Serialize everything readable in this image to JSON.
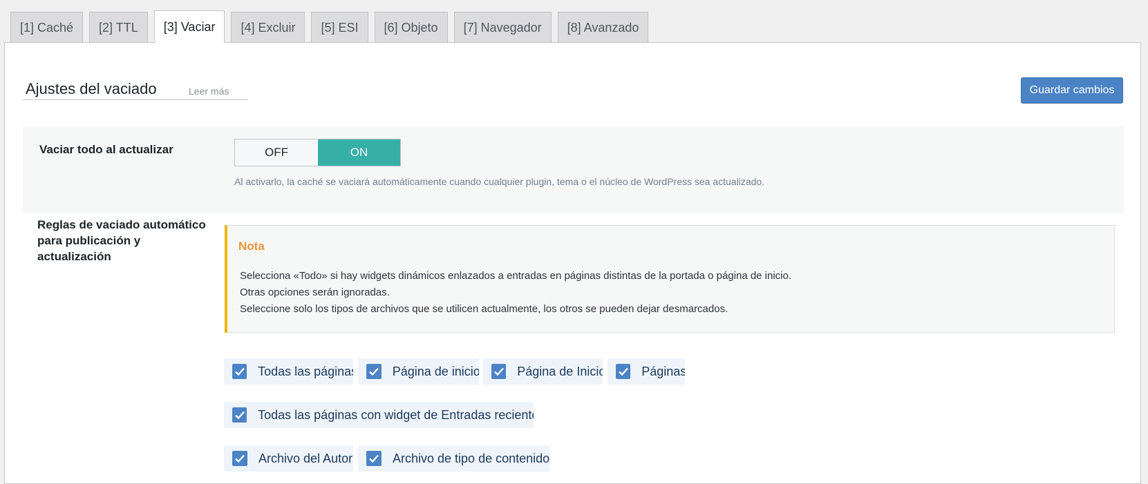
{
  "tabs": [
    {
      "label": "[1] Caché"
    },
    {
      "label": "[2] TTL"
    },
    {
      "label": "[3] Vaciar"
    },
    {
      "label": "[4] Excluir"
    },
    {
      "label": "[5] ESI"
    },
    {
      "label": "[6] Objeto"
    },
    {
      "label": "[7] Navegador"
    },
    {
      "label": "[8] Avanzado"
    }
  ],
  "active_tab": "[3] Vaciar",
  "section": {
    "title": "Ajustes del vaciado",
    "learn_more": "Leer más",
    "save_label": "Guardar cambios"
  },
  "purge_on_upgrade": {
    "label": "Vaciar todo al actualizar",
    "off_label": "OFF",
    "on_label": "ON",
    "state": "ON",
    "description": "Al activarlo, la caché se vaciará automáticamente cuando cualquier plugin, tema o el núcleo de WordPress sea actualizado."
  },
  "auto_purge": {
    "label_lines": [
      "Reglas de vaciado automático",
      "para publicación y",
      "actualización"
    ],
    "note": {
      "title": "Nota",
      "lines": [
        "Selecciona «Todo» si hay widgets dinámicos enlazados a entradas en páginas distintas de la portada o página de inicio.",
        "Otras opciones serán ignoradas.",
        "Seleccione solo los tipos de archivos que se utilicen actualmente, los otros se pueden dejar desmarcados."
      ]
    },
    "checkboxes": [
      {
        "label": "Todas las páginas",
        "checked": true
      },
      {
        "label": "Página de inicio",
        "checked": true
      },
      {
        "label": "Página de Inicio",
        "checked": true
      },
      {
        "label": "Páginas",
        "checked": true
      },
      {
        "label": "Todas las páginas con widget de Entradas recientes",
        "checked": true
      },
      {
        "label": "Archivo del Autor",
        "checked": true
      },
      {
        "label": "Archivo de tipo de contenido",
        "checked": true
      }
    ]
  },
  "colors": {
    "toggle_on": "#36b0a6",
    "primary_button": "#4b83c5",
    "note_accent": "#f0b400",
    "note_title": "#e8963a"
  }
}
